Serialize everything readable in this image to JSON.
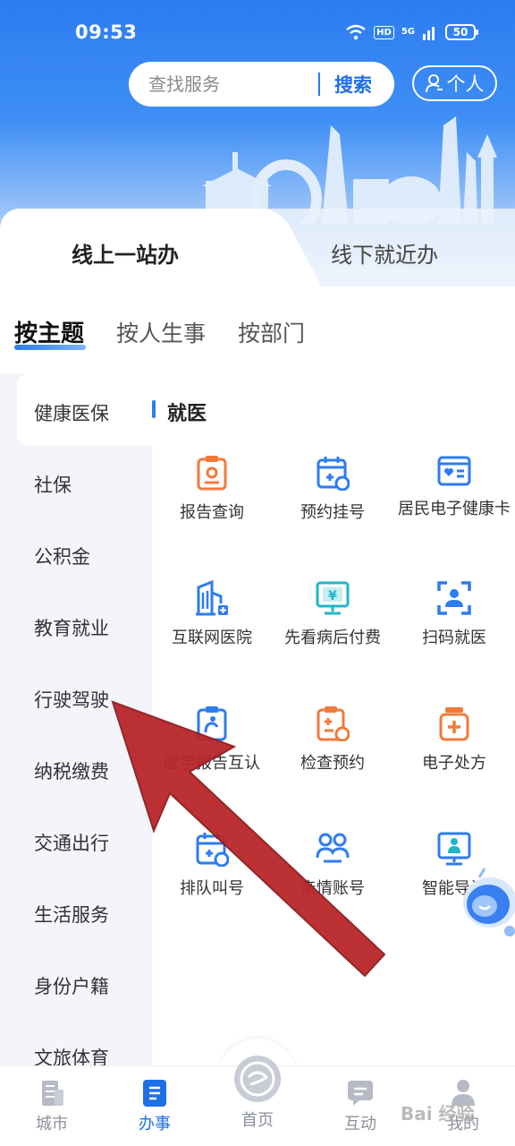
{
  "status_bar": {
    "time": "09:53",
    "hd": "HD",
    "network": "5G",
    "battery": "50"
  },
  "header": {
    "search_placeholder": "查找服务",
    "search_button": "搜索",
    "personal_button": "个人"
  },
  "mode_tabs": {
    "online": "线上一站办",
    "offline": "线下就近办"
  },
  "category_tabs": [
    "按主题",
    "按人生事",
    "按部门"
  ],
  "sidebar": {
    "items": [
      "健康医保",
      "社保",
      "公积金",
      "教育就业",
      "行驶驾驶",
      "纳税缴费",
      "交通出行",
      "生活服务",
      "身份户籍",
      "文旅体育"
    ]
  },
  "section": {
    "title": "就医",
    "services": [
      {
        "label": "报告查询",
        "icon": "report-icon"
      },
      {
        "label": "预约挂号",
        "icon": "calendar-appointment-icon"
      },
      {
        "label": "居民电子健康卡",
        "icon": "health-card-icon"
      },
      {
        "label": "互联网医院",
        "icon": "hospital-icon"
      },
      {
        "label": "先看病后付费",
        "icon": "payment-monitor-icon"
      },
      {
        "label": "扫码就医",
        "icon": "scan-code-icon"
      },
      {
        "label": "医学报告互认",
        "icon": "medical-report-icon"
      },
      {
        "label": "检查预约",
        "icon": "exam-appointment-icon"
      },
      {
        "label": "电子处方",
        "icon": "prescription-icon"
      },
      {
        "label": "排队叫号",
        "icon": "queue-icon"
      },
      {
        "label": "亲情账号",
        "icon": "family-account-icon"
      },
      {
        "label": "智能导诊",
        "icon": "smart-guide-icon"
      }
    ]
  },
  "bottom_nav": {
    "items": [
      "城市",
      "办事",
      "首页",
      "互动",
      "我的"
    ],
    "active": "办事"
  },
  "watermark": "Bai 经验",
  "colors": {
    "primary": "#2d7cf0",
    "accent_orange": "#f07a3a",
    "annotation_arrow": "#b8262a"
  }
}
